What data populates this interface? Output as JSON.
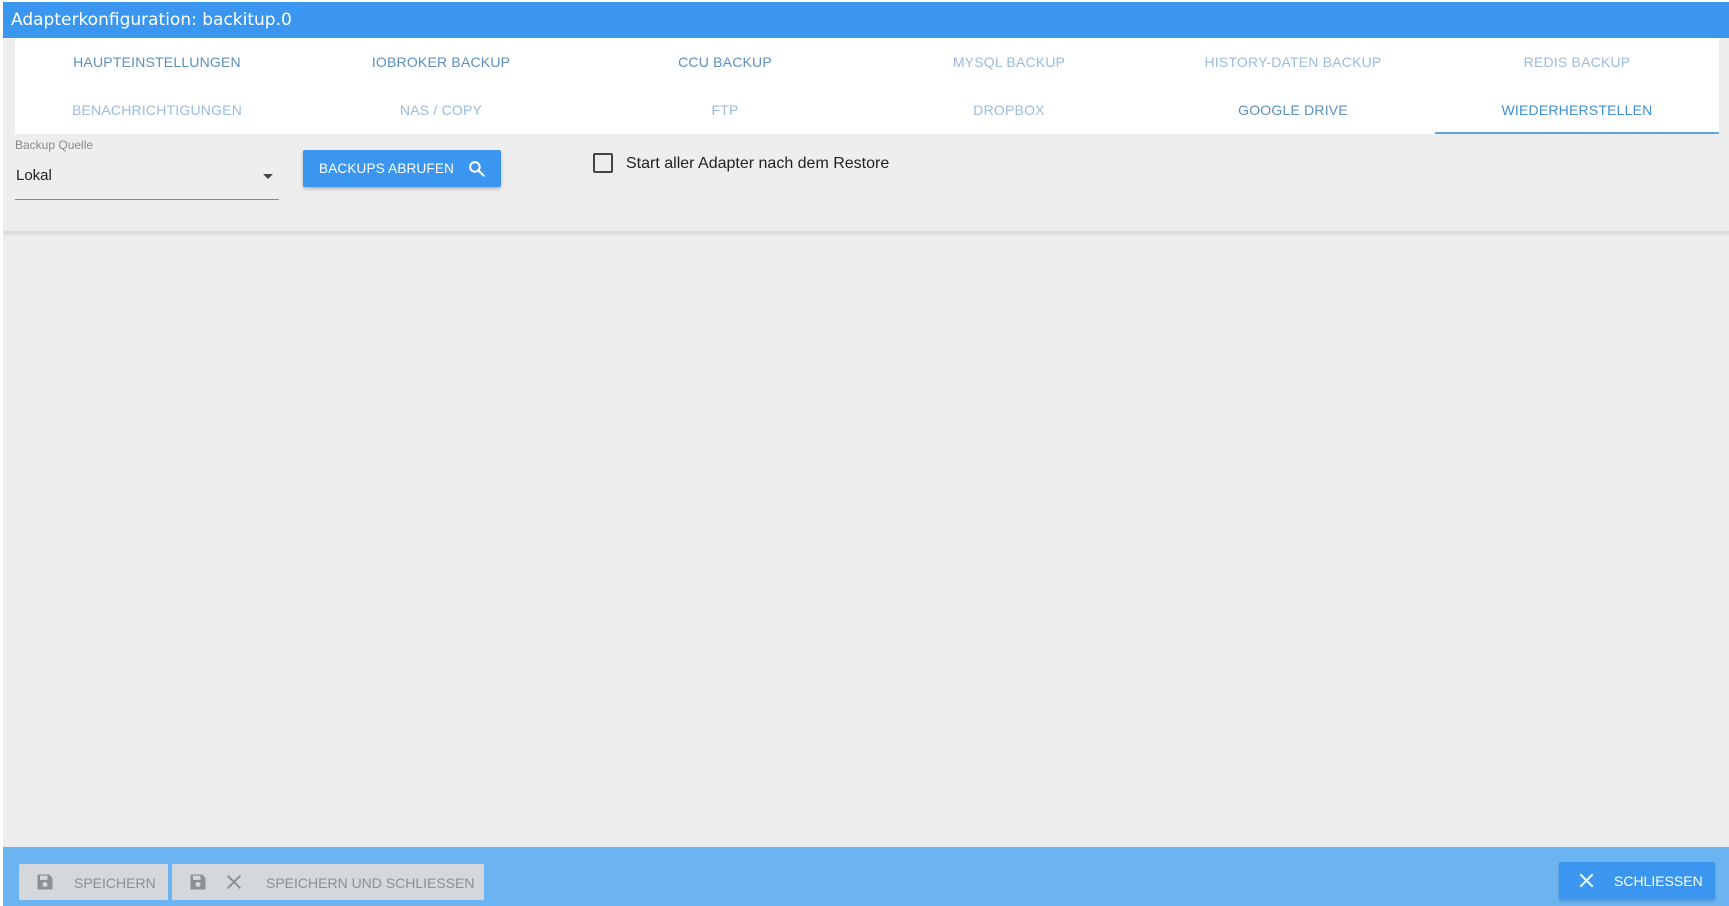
{
  "dialog": {
    "title": "Adapterkonfiguration: backitup.0"
  },
  "tabs": [
    {
      "label": "HAUPTEINSTELLUNGEN",
      "active": false
    },
    {
      "label": "IOBROKER BACKUP",
      "active": false
    },
    {
      "label": "CCU BACKUP",
      "active": false
    },
    {
      "label": "MYSQL BACKUP",
      "active": false
    },
    {
      "label": "HISTORY-DATEN BACKUP",
      "active": false
    },
    {
      "label": "REDIS BACKUP",
      "active": false
    },
    {
      "label": "BENACHRICHTIGUNGEN",
      "active": false
    },
    {
      "label": "NAS / COPY",
      "active": false
    },
    {
      "label": "FTP",
      "active": false
    },
    {
      "label": "DROPBOX",
      "active": false
    },
    {
      "label": "GOOGLE DRIVE",
      "active": false
    },
    {
      "label": "WIEDERHERSTELLEN",
      "active": true
    }
  ],
  "restore": {
    "source_label": "Backup Quelle",
    "source_value": "Lokal",
    "fetch_button": {
      "label": "BACKUPS ABRUFEN",
      "icon": "search-icon"
    },
    "start_adapters": {
      "label": "Start aller Adapter nach dem Restore",
      "checked": false
    }
  },
  "footer": {
    "save": {
      "label": "SPEICHERN",
      "icon": "floppy-disk-icon",
      "enabled": false
    },
    "save_close": {
      "label": "SPEICHERN UND SCHLIESSEN",
      "icons": [
        "floppy-disk-icon",
        "close-icon"
      ],
      "enabled": false
    },
    "close": {
      "label": "SCHLIESSEN",
      "icon": "close-icon"
    }
  },
  "colors": {
    "primary": "#3a96ee",
    "footer_bar": "#6cb4f1",
    "background": "#eeeeee",
    "disabled_button": "#d4d7db"
  }
}
